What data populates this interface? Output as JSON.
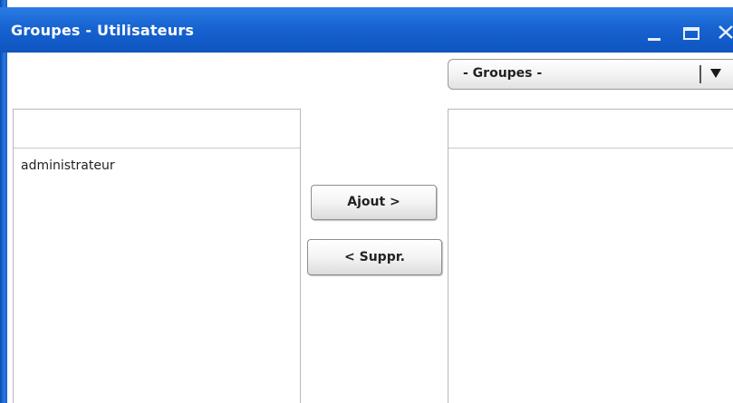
{
  "window": {
    "title": "Groupes - Utilisateurs",
    "controls": [
      "minimize-icon",
      "maximize-icon",
      "close-icon"
    ]
  },
  "group_select": {
    "selected": "- Groupes -"
  },
  "left_list": {
    "items": [
      "administrateur"
    ]
  },
  "right_list": {
    "items": []
  },
  "actions": {
    "add_label": "Ajout >",
    "remove_label": "< Suppr."
  },
  "colors": {
    "titlebar": "#1763d1",
    "title_text": "#ffffff",
    "panel_border": "#b8b8b8"
  }
}
